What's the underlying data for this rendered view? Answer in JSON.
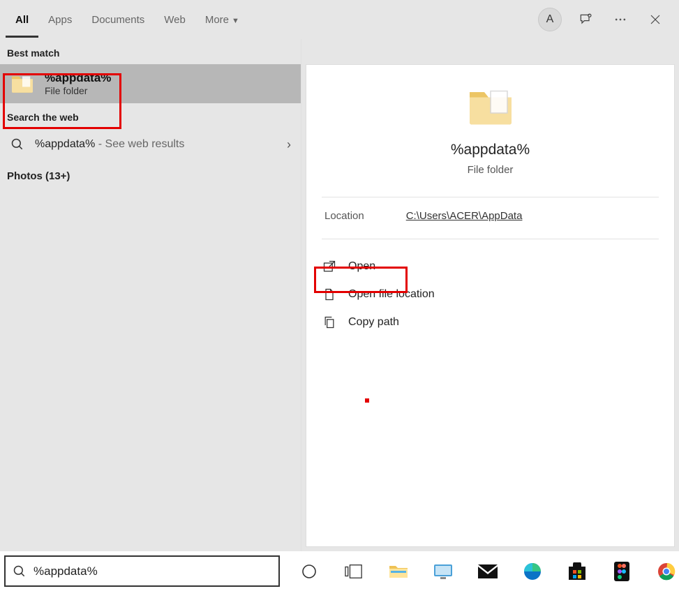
{
  "header": {
    "tabs": [
      "All",
      "Apps",
      "Documents",
      "Web",
      "More"
    ],
    "activeTab": "All",
    "avatar": "A"
  },
  "left": {
    "bestMatchLabel": "Best match",
    "bestMatch": {
      "title": "%appdata%",
      "subtitle": "File folder"
    },
    "webLabel": "Search the web",
    "webResult": {
      "query": "%appdata%",
      "suffix": " - See web results"
    },
    "photosLabel": "Photos (13+)"
  },
  "right": {
    "title": "%appdata%",
    "subtitle": "File folder",
    "locationLabel": "Location",
    "locationPath": "C:\\Users\\ACER\\AppData",
    "actions": {
      "open": "Open",
      "openFileLocation": "Open file location",
      "copyPath": "Copy path"
    }
  },
  "search": {
    "value": "%appdata%"
  }
}
